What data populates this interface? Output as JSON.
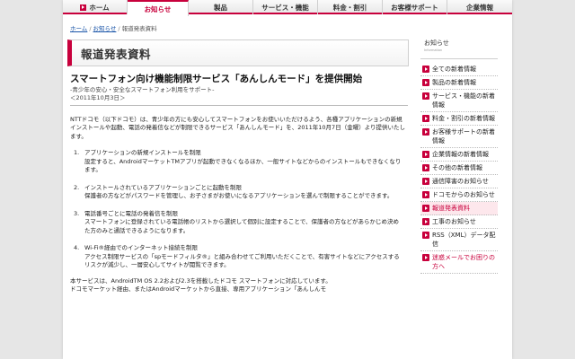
{
  "nav": {
    "items": [
      {
        "label": "ホーム",
        "active": false
      },
      {
        "label": "お知らせ",
        "active": true
      },
      {
        "label": "製品",
        "active": false
      },
      {
        "label": "サービス・機能",
        "active": false
      },
      {
        "label": "料金・割引",
        "active": false
      },
      {
        "label": "お客様サポート",
        "active": false
      },
      {
        "label": "企業情報",
        "active": false
      }
    ]
  },
  "breadcrumb": {
    "home": "ホーム",
    "news": "お知らせ",
    "current": "報道発表資料",
    "sep": "/"
  },
  "page": {
    "heading": "報道発表資料"
  },
  "article": {
    "title": "スマートフォン向け機能制限サービス「あんしんモード」を提供開始",
    "subtitle": "-青少年の安心・安全なスマートフォン利用をサポート-",
    "date": "＜2011年10月3日＞",
    "intro": "NTTドコモ（以下ドコモ）は、青少年の方にも安心してスマートフォンをお使いいただけるよう、各種アプリケーションの新規インストールや起動、電話の発着信などが制限できるサービス「あんしんモード」を、2011年10月7日（金曜）より提供いたします。",
    "items": [
      {
        "num": "1.",
        "title": "アプリケーションの新規インストールを制限",
        "desc": "設定すると、AndroidマーケットTMアプリが起動できなくなるほか、一般サイトなどからのインストールもできなくなります。"
      },
      {
        "num": "2.",
        "title": "インストールされているアプリケーションごとに起動を制限",
        "desc": "保護者の方などがパスワードを管理し、お子さまがお使いになるアプリケーションを選んで制限することができます。"
      },
      {
        "num": "3.",
        "title": "電話番号ごとに電話の発着信を制限",
        "desc": "スマートフォンに登録されている電話帳のリストから選択して個別に設定することで、保護者の方などがあらかじめ決めた方のみと通話できるようになります。"
      },
      {
        "num": "4.",
        "title": "Wi-Fi®経由でのインターネット接続を制限",
        "desc": "アクセス制限サービスの「spモードフィルタ®」と組み合わせてご利用いただくことで、有害サイトなどにアクセスするリスクが減少し、一層安心してサイトが閲覧できます。"
      }
    ],
    "footer_1": "本サービスは、AndroidTM OS 2.2および2.3を搭載したドコモ スマートフォンに対応しています。",
    "footer_2": "ドコモマーケット経由、またはAndroidマーケットから直接、専用アプリケーション「あんしんモ"
  },
  "sidebar": {
    "title": "お知らせ",
    "subtitle": "Information",
    "items": [
      {
        "label": "全ての新着情報",
        "state": "normal"
      },
      {
        "label": "製品の新着情報",
        "state": "normal"
      },
      {
        "label": "サービス・機能の新着情報",
        "state": "normal"
      },
      {
        "label": "料金・割引の新着情報",
        "state": "normal"
      },
      {
        "label": "お客様サポートの新着情報",
        "state": "normal"
      },
      {
        "label": "企業情報の新着情報",
        "state": "normal"
      },
      {
        "label": "その他の新着情報",
        "state": "normal"
      },
      {
        "label": "通信障害のお知らせ",
        "state": "normal"
      },
      {
        "label": "ドコモからのお知らせ",
        "state": "normal"
      },
      {
        "label": "報道発表資料",
        "state": "active"
      },
      {
        "label": "工事のお知らせ",
        "state": "normal"
      },
      {
        "label": "RSS（XML）データ配信",
        "state": "normal"
      },
      {
        "label": "迷惑メールでお困りの方へ",
        "state": "alert"
      }
    ]
  },
  "colors": {
    "accent": "#c8003c",
    "link": "#1a55a8"
  }
}
